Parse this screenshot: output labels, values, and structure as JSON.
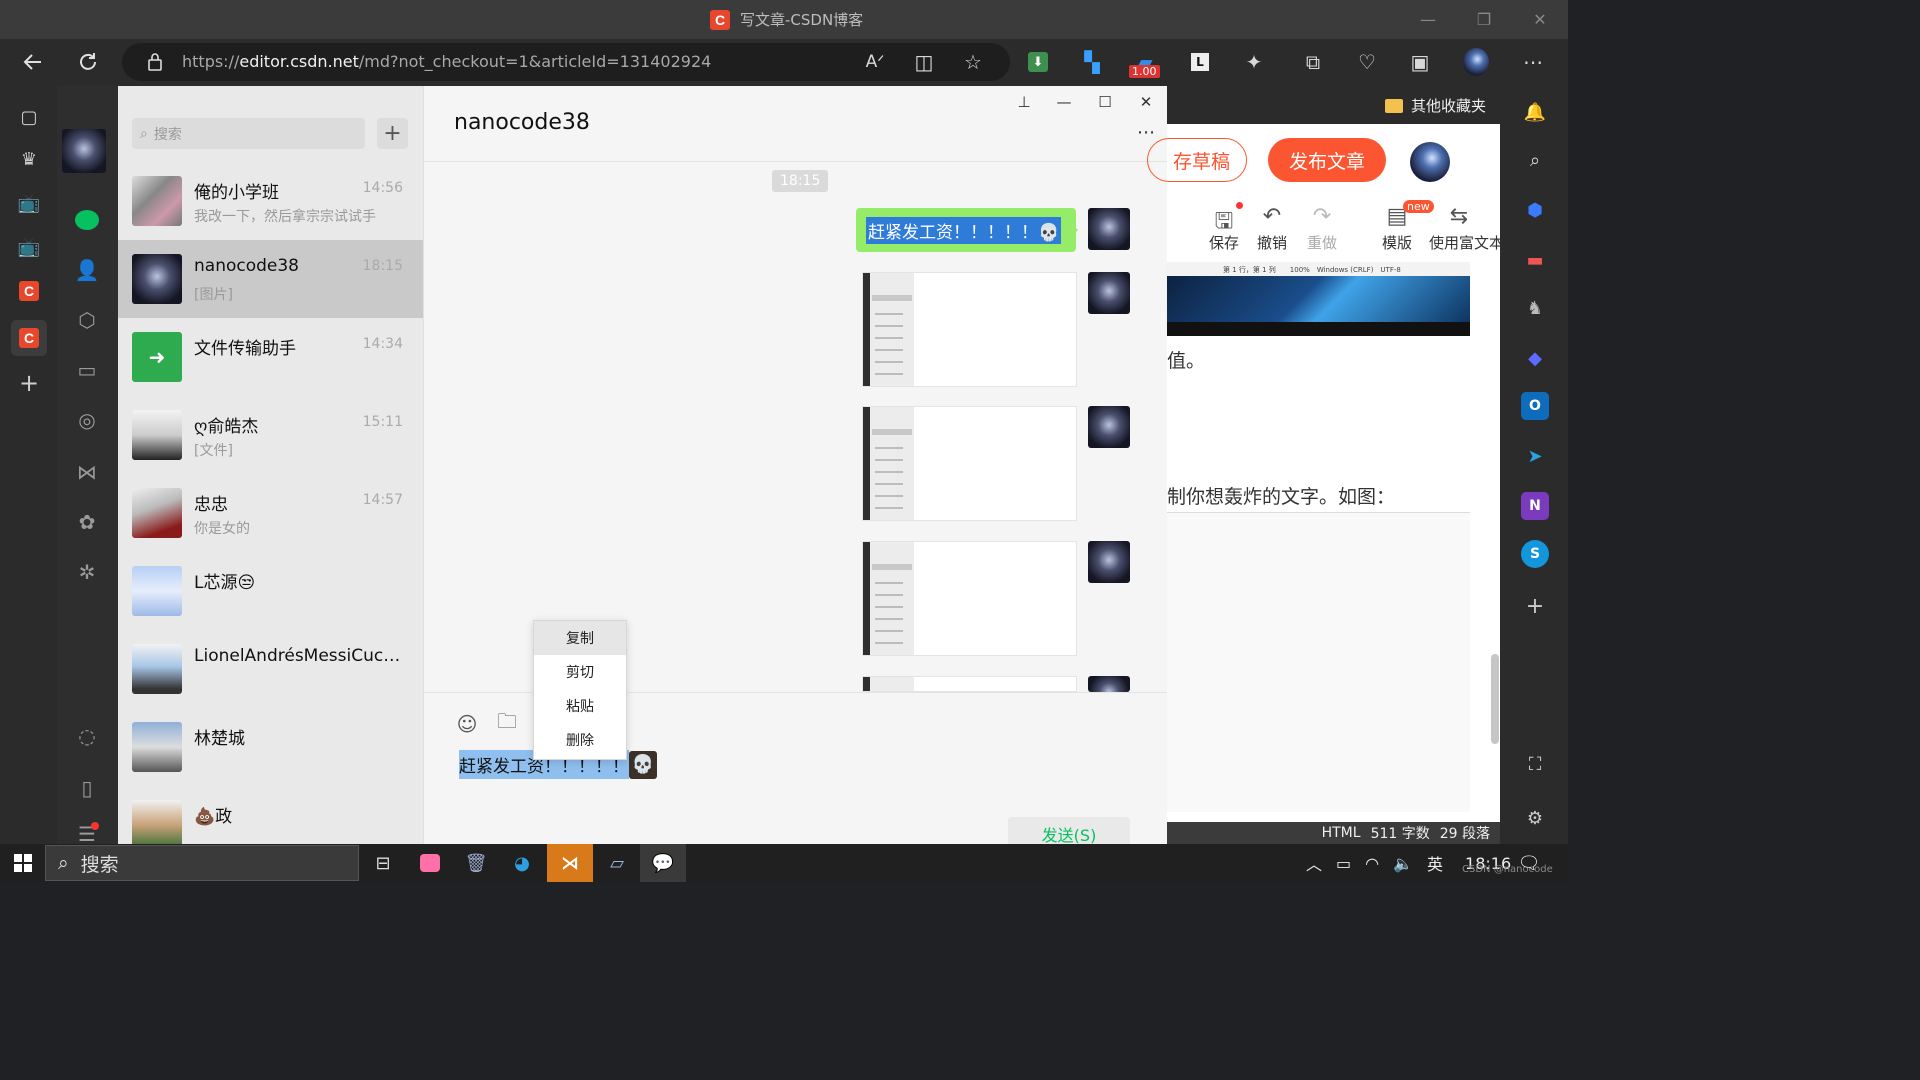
{
  "titlebar": {
    "title": "写文章-CSDN博客",
    "icon_letter": "C"
  },
  "browser": {
    "url_prefix": "https://",
    "url_host": "editor.csdn.net",
    "url_path": "/md?not_checkout=1&articleId=131402924",
    "badge_value": "1.00",
    "fav_folder": "其他收藏夹"
  },
  "wechat": {
    "search_placeholder": "搜索",
    "plus_label": "+",
    "chats": [
      {
        "name": "俺的小学班",
        "time": "14:56",
        "preview": "我改一下，然后拿宗宗试试手"
      },
      {
        "name": "nanocode38",
        "time": "18:15",
        "preview": "[图片]"
      },
      {
        "name": "文件传输助手",
        "time": "14:34",
        "preview": ""
      },
      {
        "name": "ღ俞皓杰",
        "time": "15:11",
        "preview": "[文件]"
      },
      {
        "name": "忠忠",
        "time": "14:57",
        "preview": "你是女的"
      },
      {
        "name": "L芯源😒",
        "time": "",
        "preview": ""
      },
      {
        "name": "LionelAndrésMessiCucci...",
        "time": "",
        "preview": ""
      },
      {
        "name": "林楚城",
        "time": "",
        "preview": ""
      },
      {
        "name": "💩政",
        "time": "",
        "preview": ""
      }
    ],
    "conversation": {
      "title": "nanocode38",
      "time_chip": "18:15",
      "bubble_text": "赶紧发工资！！！！！💀",
      "typed_text": "赶紧发工资！！！！！",
      "send_label": "发送(S)"
    },
    "context_menu": [
      "复制",
      "剪切",
      "粘贴",
      "删除"
    ]
  },
  "csdn": {
    "save_draft": "存草稿",
    "publish": "发布文章",
    "toolbar": [
      {
        "label": "保存",
        "icon": "save-icon"
      },
      {
        "label": "撤销",
        "icon": "undo-icon"
      },
      {
        "label": "重做",
        "icon": "redo-icon"
      },
      {
        "label": "模版",
        "icon": "template-icon",
        "badge": "new"
      },
      {
        "label": "使用富文本",
        "icon": "switch-icon"
      }
    ],
    "preview_status": "第 1 行，第 1 列　　100%　Windows (CRLF)　UTF-8",
    "text_line1": "值。",
    "text_line2": "制你想轰炸的文字。如图：",
    "status": {
      "mode": "HTML",
      "words": "511 字数",
      "paras": "29 段落"
    }
  },
  "taskbar": {
    "search_label": "搜索",
    "ime": "英",
    "clock": "18:16",
    "watermark": "CSDN @nanocode"
  },
  "colors": {
    "wechat_green": "#07c160",
    "bubble_green": "#95ec69",
    "csdn_red": "#fc5531"
  }
}
